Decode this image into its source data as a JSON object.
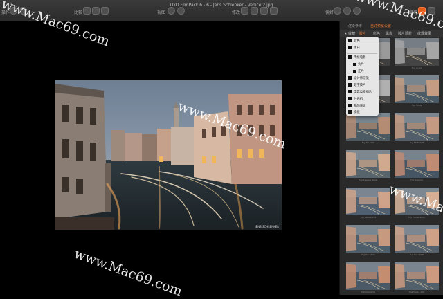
{
  "window": {
    "title": "DxO FilmPack 6 - 6 - Jens Schlenker - Venice 2.jpg"
  },
  "toolbar": {
    "left_label": "操作",
    "compare_label": "比较",
    "view_label": "视图",
    "edit_label": "修改",
    "settings_label": "偏好",
    "export_label": "显示"
  },
  "photo": {
    "credit": "JENS SCHLENKER"
  },
  "panel": {
    "tabs": [
      "渲染参考",
      "自订预览设置"
    ],
    "active_tab": 1,
    "filter_items": [
      "★ 收藏",
      "胶片",
      "彩色",
      "黑白",
      "胶片颗粒",
      "纹理效果"
    ],
    "active_filter": 1
  },
  "dropdown": {
    "items": [
      "颜色",
      "黑白",
      "传统电影",
      "负片",
      "正片",
      "设计师渲染",
      "数字胶片",
      "电影类模拟片",
      "时光机",
      "我的预设",
      "模板"
    ]
  },
  "thumbnails": [
    {
      "caption": ""
    },
    {
      "caption": "Fuji Acros"
    },
    {
      "caption": "Fuji Astia"
    },
    {
      "caption": "Fuji Fortia"
    },
    {
      "caption": "Fuji FP-100C"
    },
    {
      "caption": "Fuji FP-3000B"
    },
    {
      "caption": "Fuji Superia Reala"
    },
    {
      "caption": "Fuji Superia"
    },
    {
      "caption": "Fuji Sensia 100"
    },
    {
      "caption": "Fuji Provia 400X"
    },
    {
      "caption": "Fuji Pro 160C"
    },
    {
      "caption": "Fuji Pro 400H"
    },
    {
      "caption": "Fuji Velvia 50"
    },
    {
      "caption": "Fuji Velvia 100"
    }
  ],
  "watermark": {
    "text": "www.Mac69.com"
  },
  "colors": {
    "accent": "#e8722f",
    "panel": "#2a2a2a",
    "titlebar": "#333333"
  }
}
